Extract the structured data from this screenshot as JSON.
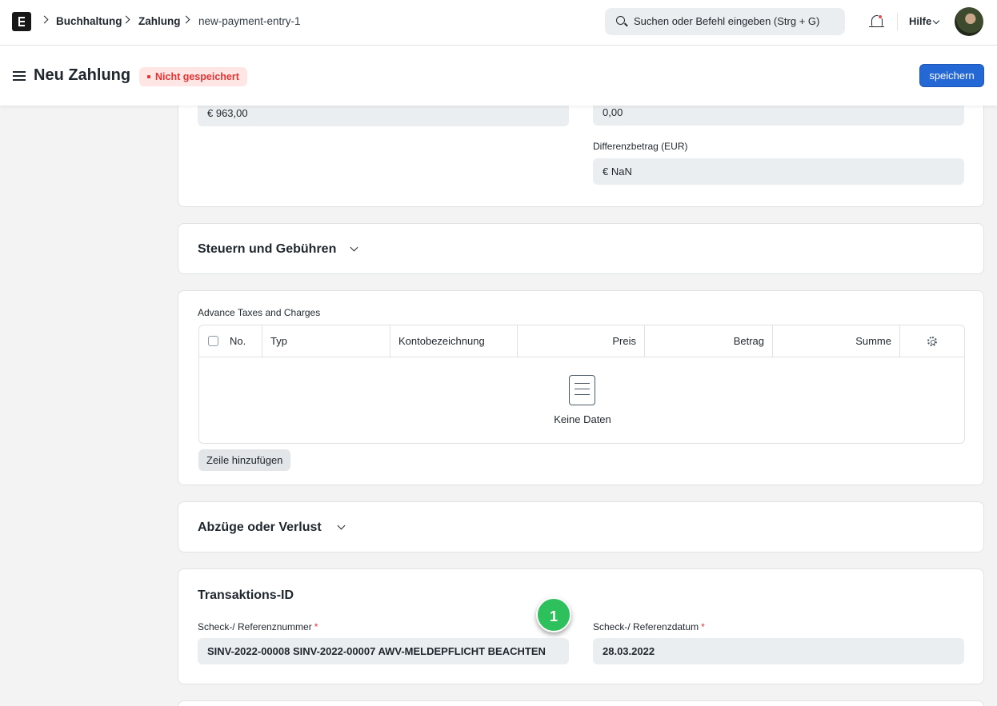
{
  "navbar": {
    "breadcrumbs": [
      "Buchhaltung",
      "Zahlung",
      "new-payment-entry-1"
    ],
    "search_placeholder": "Suchen oder Befehl eingeben (Strg + G)",
    "help_label": "Hilfe"
  },
  "page": {
    "title": "Neu Zahlung",
    "status_badge": "Nicht gespeichert",
    "save_label": "speichern"
  },
  "amounts": {
    "left_value": "€ 963,00",
    "right_value": "0,00",
    "difference_label": "Differenzbetrag (EUR)",
    "difference_value": "€ NaN"
  },
  "taxes_section": {
    "title": "Steuern und Gebühren"
  },
  "advance_taxes": {
    "label": "Advance Taxes and Charges",
    "columns": [
      "No.",
      "Typ",
      "Kontobezeichnung",
      "Preis",
      "Betrag",
      "Summe"
    ],
    "empty_text": "Keine Daten",
    "add_row_label": "Zeile hinzufügen"
  },
  "deductions_section": {
    "title": "Abzüge oder Verlust"
  },
  "transaction": {
    "title": "Transaktions-ID",
    "ref_no_label": "Scheck-/ Referenznummer",
    "ref_no_value": "SINV-2022-00008 SINV-2022-00007 AWV-MELDEPFLICHT BEACHTEN",
    "ref_date_label": "Scheck-/ Referenzdatum",
    "ref_date_value": "28.03.2022",
    "required_mark": "*"
  },
  "marker": {
    "label": "1",
    "color": "#2ec05c"
  },
  "colors": {
    "primary": "#2468d6",
    "danger": "#e03636",
    "field_bg": "#ebeef0"
  }
}
